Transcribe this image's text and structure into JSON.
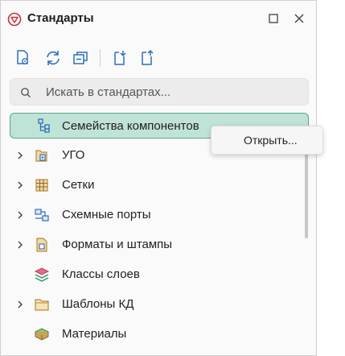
{
  "panel": {
    "title": "Стандарты"
  },
  "search": {
    "placeholder": "Искать в стандартах..."
  },
  "tree": {
    "items": [
      {
        "label": "Семейства компонентов",
        "icon": "component-family-icon",
        "selected": true,
        "expandable": false
      },
      {
        "label": "УГО",
        "icon": "ugo-symbol-icon",
        "selected": false,
        "expandable": true
      },
      {
        "label": "Сетки",
        "icon": "grid-icon",
        "selected": false,
        "expandable": true
      },
      {
        "label": "Схемные порты",
        "icon": "schematic-ports-icon",
        "selected": false,
        "expandable": true
      },
      {
        "label": "Форматы и штампы",
        "icon": "format-stamp-icon",
        "selected": false,
        "expandable": true
      },
      {
        "label": "Классы слоев",
        "icon": "layer-classes-icon",
        "selected": false,
        "expandable": false
      },
      {
        "label": "Шаблоны КД",
        "icon": "folder-icon",
        "selected": false,
        "expandable": true
      },
      {
        "label": "Материалы",
        "icon": "materials-icon",
        "selected": false,
        "expandable": false
      }
    ]
  },
  "context_menu": {
    "items": [
      {
        "label": "Открыть..."
      }
    ]
  },
  "colors": {
    "selected_bg": "#bfe3d6",
    "selected_border": "#5aa88c",
    "icon_blue": "#2f6fb8",
    "icon_green": "#2e9a6e",
    "logo_red": "#c0343b"
  }
}
